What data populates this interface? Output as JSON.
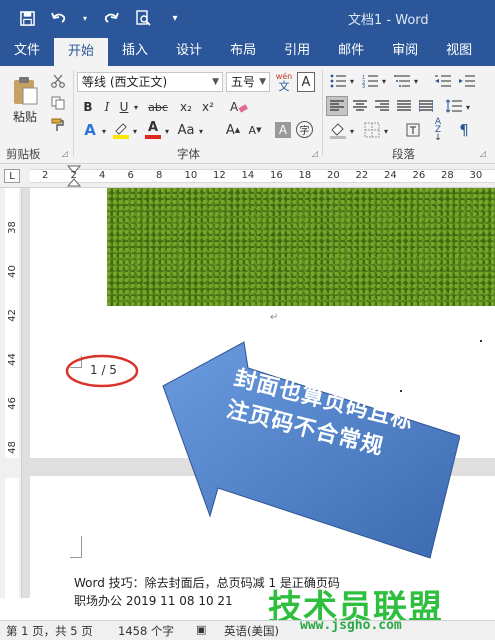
{
  "window": {
    "title": "文档1 - Word"
  },
  "tabs": [
    "文件",
    "开始",
    "插入",
    "设计",
    "布局",
    "引用",
    "邮件",
    "审阅",
    "视图"
  ],
  "active_tab": "开始",
  "clipboard": {
    "paste_label": "粘贴",
    "group_label": "剪贴板"
  },
  "font": {
    "family": "等线 (西文正文)",
    "size": "五号",
    "wen_label": "wén",
    "wen_char": "文",
    "group_label": "字体",
    "style_buttons": [
      "B",
      "I",
      "U",
      "abc",
      "x₂",
      "x²"
    ],
    "aa_label": "Aa"
  },
  "paragraph": {
    "group_label": "段落"
  },
  "ruler": {
    "corner": "L",
    "h_ticks": [
      "2",
      "2",
      "4",
      "6",
      "8",
      "10",
      "12",
      "14",
      "16",
      "18",
      "20",
      "22",
      "24",
      "26",
      "28",
      "30"
    ],
    "v_ticks": [
      "38",
      "40",
      "42",
      "44",
      "46",
      "48"
    ]
  },
  "document": {
    "page_marker": "1 / 5",
    "callout_text": "封面也算页码且标注页码不合常规",
    "line1": "Word 技巧：除去封面后，总页码减 1 是正确页码",
    "line2": "职场办公 2019 11 08 10 21"
  },
  "status": {
    "page": "第 1 页，共 5 页",
    "words": "1458 个字",
    "lang": "英语(美国)"
  },
  "watermark": {
    "brand": "技术员联盟",
    "url": "www.jsgho.com"
  },
  "colors": {
    "accent": "#2b579a",
    "callout": "#4a7bc0",
    "circle": "#d9342b",
    "watermark": "#2fbf3f"
  }
}
